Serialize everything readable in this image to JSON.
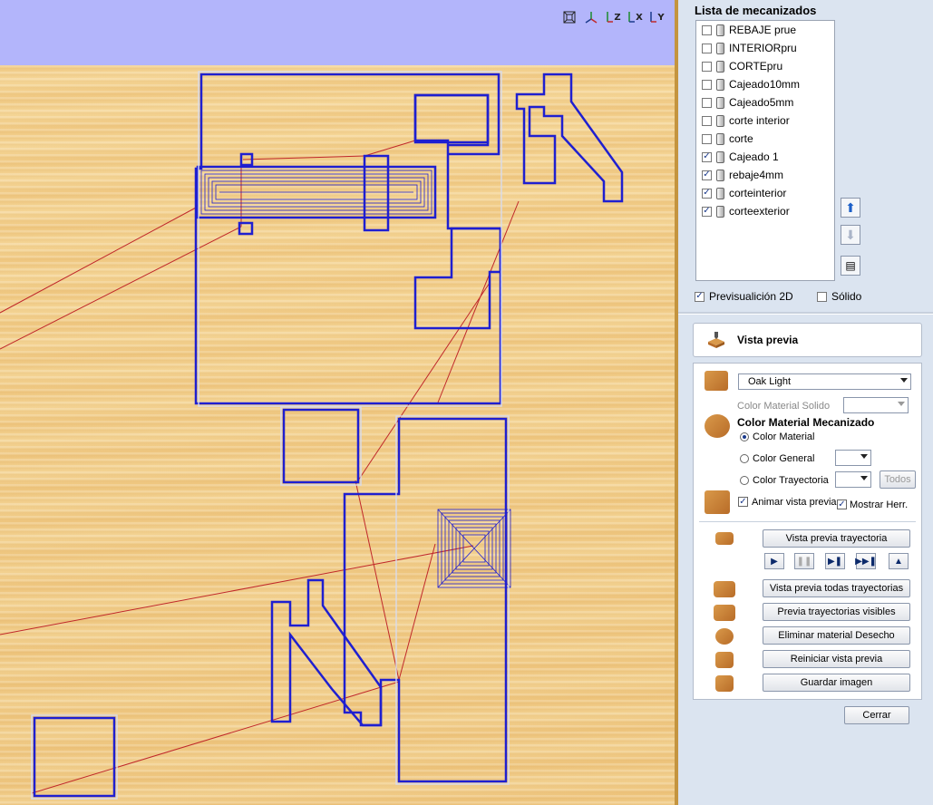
{
  "viewport": {
    "view_icons": [
      "iso-view-icon",
      "iso-axes-icon",
      "view-z-icon",
      "view-x-icon",
      "view-y-icon"
    ],
    "view_labels": {
      "iso": "",
      "z": "Z",
      "x": "X",
      "y": "Y"
    },
    "colors": {
      "header": "#b3b5fb",
      "toolpath": "#1f1fd0",
      "rapid": "#c0282a",
      "wood": "#f0cd8b"
    }
  },
  "panel": {
    "title": "Lista de mecanizados",
    "operations": [
      {
        "name": "REBAJE prue",
        "checked": false
      },
      {
        "name": "INTERIORpru",
        "checked": false
      },
      {
        "name": "CORTEpru",
        "checked": false
      },
      {
        "name": "Cajeado10mm",
        "checked": false
      },
      {
        "name": "Cajeado5mm",
        "checked": false
      },
      {
        "name": "corte interior",
        "checked": false
      },
      {
        "name": "corte",
        "checked": false
      },
      {
        "name": "Cajeado 1",
        "checked": true
      },
      {
        "name": "rebaje4mm",
        "checked": true
      },
      {
        "name": "corteinterior",
        "checked": true
      },
      {
        "name": "corteexterior",
        "checked": true
      }
    ],
    "preview2d_label": "Previsualición 2D",
    "preview2d_checked": true,
    "solid_label": "Sólido",
    "solid_checked": false,
    "vista_previa_label": "Vista previa",
    "material_select": "Oak Light",
    "color_material_solido_label": "Color Material Solido",
    "color_material_mecanizado_label": "Color Material Mecanizado",
    "radio_color_material": "Color Material",
    "radio_color_general": "Color General",
    "radio_color_trayectoria": "Color Trayectoria",
    "todos_label": "Todos",
    "animar_label": "Animar vista previa",
    "animar_checked": true,
    "mostrar_label": "Mostrar Herr.",
    "mostrar_checked": true,
    "btn_vista_previa_trayectoria": "Vista previa trayectoria",
    "btn_vista_previa_todas": "Vista previa todas trayectorias",
    "btn_previa_visibles": "Previa trayectorias visibles",
    "btn_eliminar": "Eliminar material Desecho",
    "btn_reiniciar": "Reiniciar vista previa",
    "btn_guardar": "Guardar imagen",
    "btn_cerrar": "Cerrar"
  }
}
